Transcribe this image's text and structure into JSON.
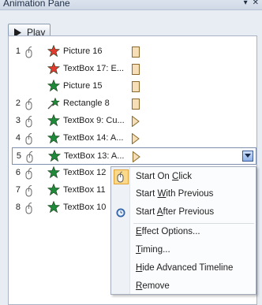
{
  "window": {
    "title": "Animation Pane",
    "pin_icon": "pin-icon",
    "close_icon": "close-icon"
  },
  "toolbar": {
    "play_label": "Play",
    "play_icon": "play-icon"
  },
  "animations": [
    {
      "number": "1",
      "trigger": "on-click",
      "effect": "red-star",
      "name": "Picture 16",
      "timing": "box"
    },
    {
      "number": "",
      "trigger": "",
      "effect": "red-star",
      "name": "TextBox 17: E...",
      "timing": "box"
    },
    {
      "number": "",
      "trigger": "",
      "effect": "green-star",
      "name": "Picture 15",
      "timing": "box"
    },
    {
      "number": "2",
      "trigger": "on-click",
      "effect": "green-motion",
      "name": "Rectangle 8",
      "timing": "box"
    },
    {
      "number": "3",
      "trigger": "on-click",
      "effect": "green-star",
      "name": "TextBox 9: Cu...",
      "timing": "arrow"
    },
    {
      "number": "4",
      "trigger": "on-click",
      "effect": "green-star",
      "name": "TextBox 14: A...",
      "timing": "arrow"
    },
    {
      "number": "5",
      "trigger": "on-click",
      "effect": "green-star",
      "name": "TextBox 13: A...",
      "timing": "arrow",
      "selected": true
    },
    {
      "number": "6",
      "trigger": "on-click",
      "effect": "green-star",
      "name": "TextBox 12",
      "timing": ""
    },
    {
      "number": "7",
      "trigger": "on-click",
      "effect": "green-star",
      "name": "TextBox 11",
      "timing": ""
    },
    {
      "number": "8",
      "trigger": "on-click",
      "effect": "green-star",
      "name": "TextBox 10",
      "timing": ""
    }
  ],
  "context_menu": {
    "start_on_click": {
      "pre": "Start On ",
      "u": "C",
      "post": "lick"
    },
    "start_with_previous": {
      "pre": "Start ",
      "u": "W",
      "post": "ith Previous"
    },
    "start_after_previous": {
      "pre": "Start ",
      "u": "A",
      "post": "fter Previous"
    },
    "effect_options": {
      "pre": "",
      "u": "E",
      "post": "ffect Options..."
    },
    "timing": {
      "pre": "",
      "u": "T",
      "post": "iming..."
    },
    "hide_advanced_timeline": {
      "pre": "",
      "u": "H",
      "post": "ide Advanced Timeline"
    },
    "remove": {
      "pre": "",
      "u": "R",
      "post": "emove"
    }
  },
  "colors": {
    "pane_bg": "#e8edf4",
    "selection_border": "#7d8fac",
    "checked_highlight": "#fbd98a",
    "red_star": "#e23a2e",
    "green_star": "#1e8a3a",
    "timing_box": "#f6dfb8"
  }
}
